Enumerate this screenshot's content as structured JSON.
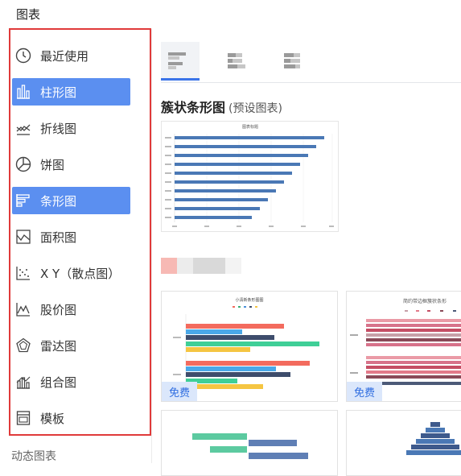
{
  "header": {
    "title": "图表"
  },
  "sidebar": {
    "items": [
      {
        "label": "最近使用",
        "icon": "clock-icon",
        "active": false
      },
      {
        "label": "柱形图",
        "icon": "bar-chart-icon",
        "active": true
      },
      {
        "label": "折线图",
        "icon": "line-chart-icon",
        "active": false
      },
      {
        "label": "饼图",
        "icon": "pie-chart-icon",
        "active": false
      },
      {
        "label": "条形图",
        "icon": "horizontal-bar-icon",
        "active": true
      },
      {
        "label": "面积图",
        "icon": "area-chart-icon",
        "active": false
      },
      {
        "label": "X Y（散点图）",
        "icon": "scatter-chart-icon",
        "active": false
      },
      {
        "label": "股价图",
        "icon": "stock-chart-icon",
        "active": false
      },
      {
        "label": "雷达图",
        "icon": "radar-chart-icon",
        "active": false
      },
      {
        "label": "组合图",
        "icon": "combo-chart-icon",
        "active": false
      },
      {
        "label": "模板",
        "icon": "template-icon",
        "active": false
      }
    ],
    "footer": "动态图表"
  },
  "subtypes": {
    "active_index": 0,
    "icons": [
      "clustered-bar-icon",
      "stacked-bar-icon",
      "percent-stacked-bar-icon"
    ]
  },
  "section": {
    "title": "簇状条形图",
    "subtitle": "(预设图表)"
  },
  "preview_chart": {
    "title": "图表标题"
  },
  "templates": [
    {
      "title": "小清新条形图图",
      "badge": "免费"
    },
    {
      "title": "简约带边框簇状条形",
      "badge": "免费"
    }
  ],
  "colors": {
    "accent": "#5b8ff0",
    "highlight_border": "#e03a3a",
    "badge_bg": "#dbe7fb",
    "badge_text": "#2d6ce0"
  }
}
